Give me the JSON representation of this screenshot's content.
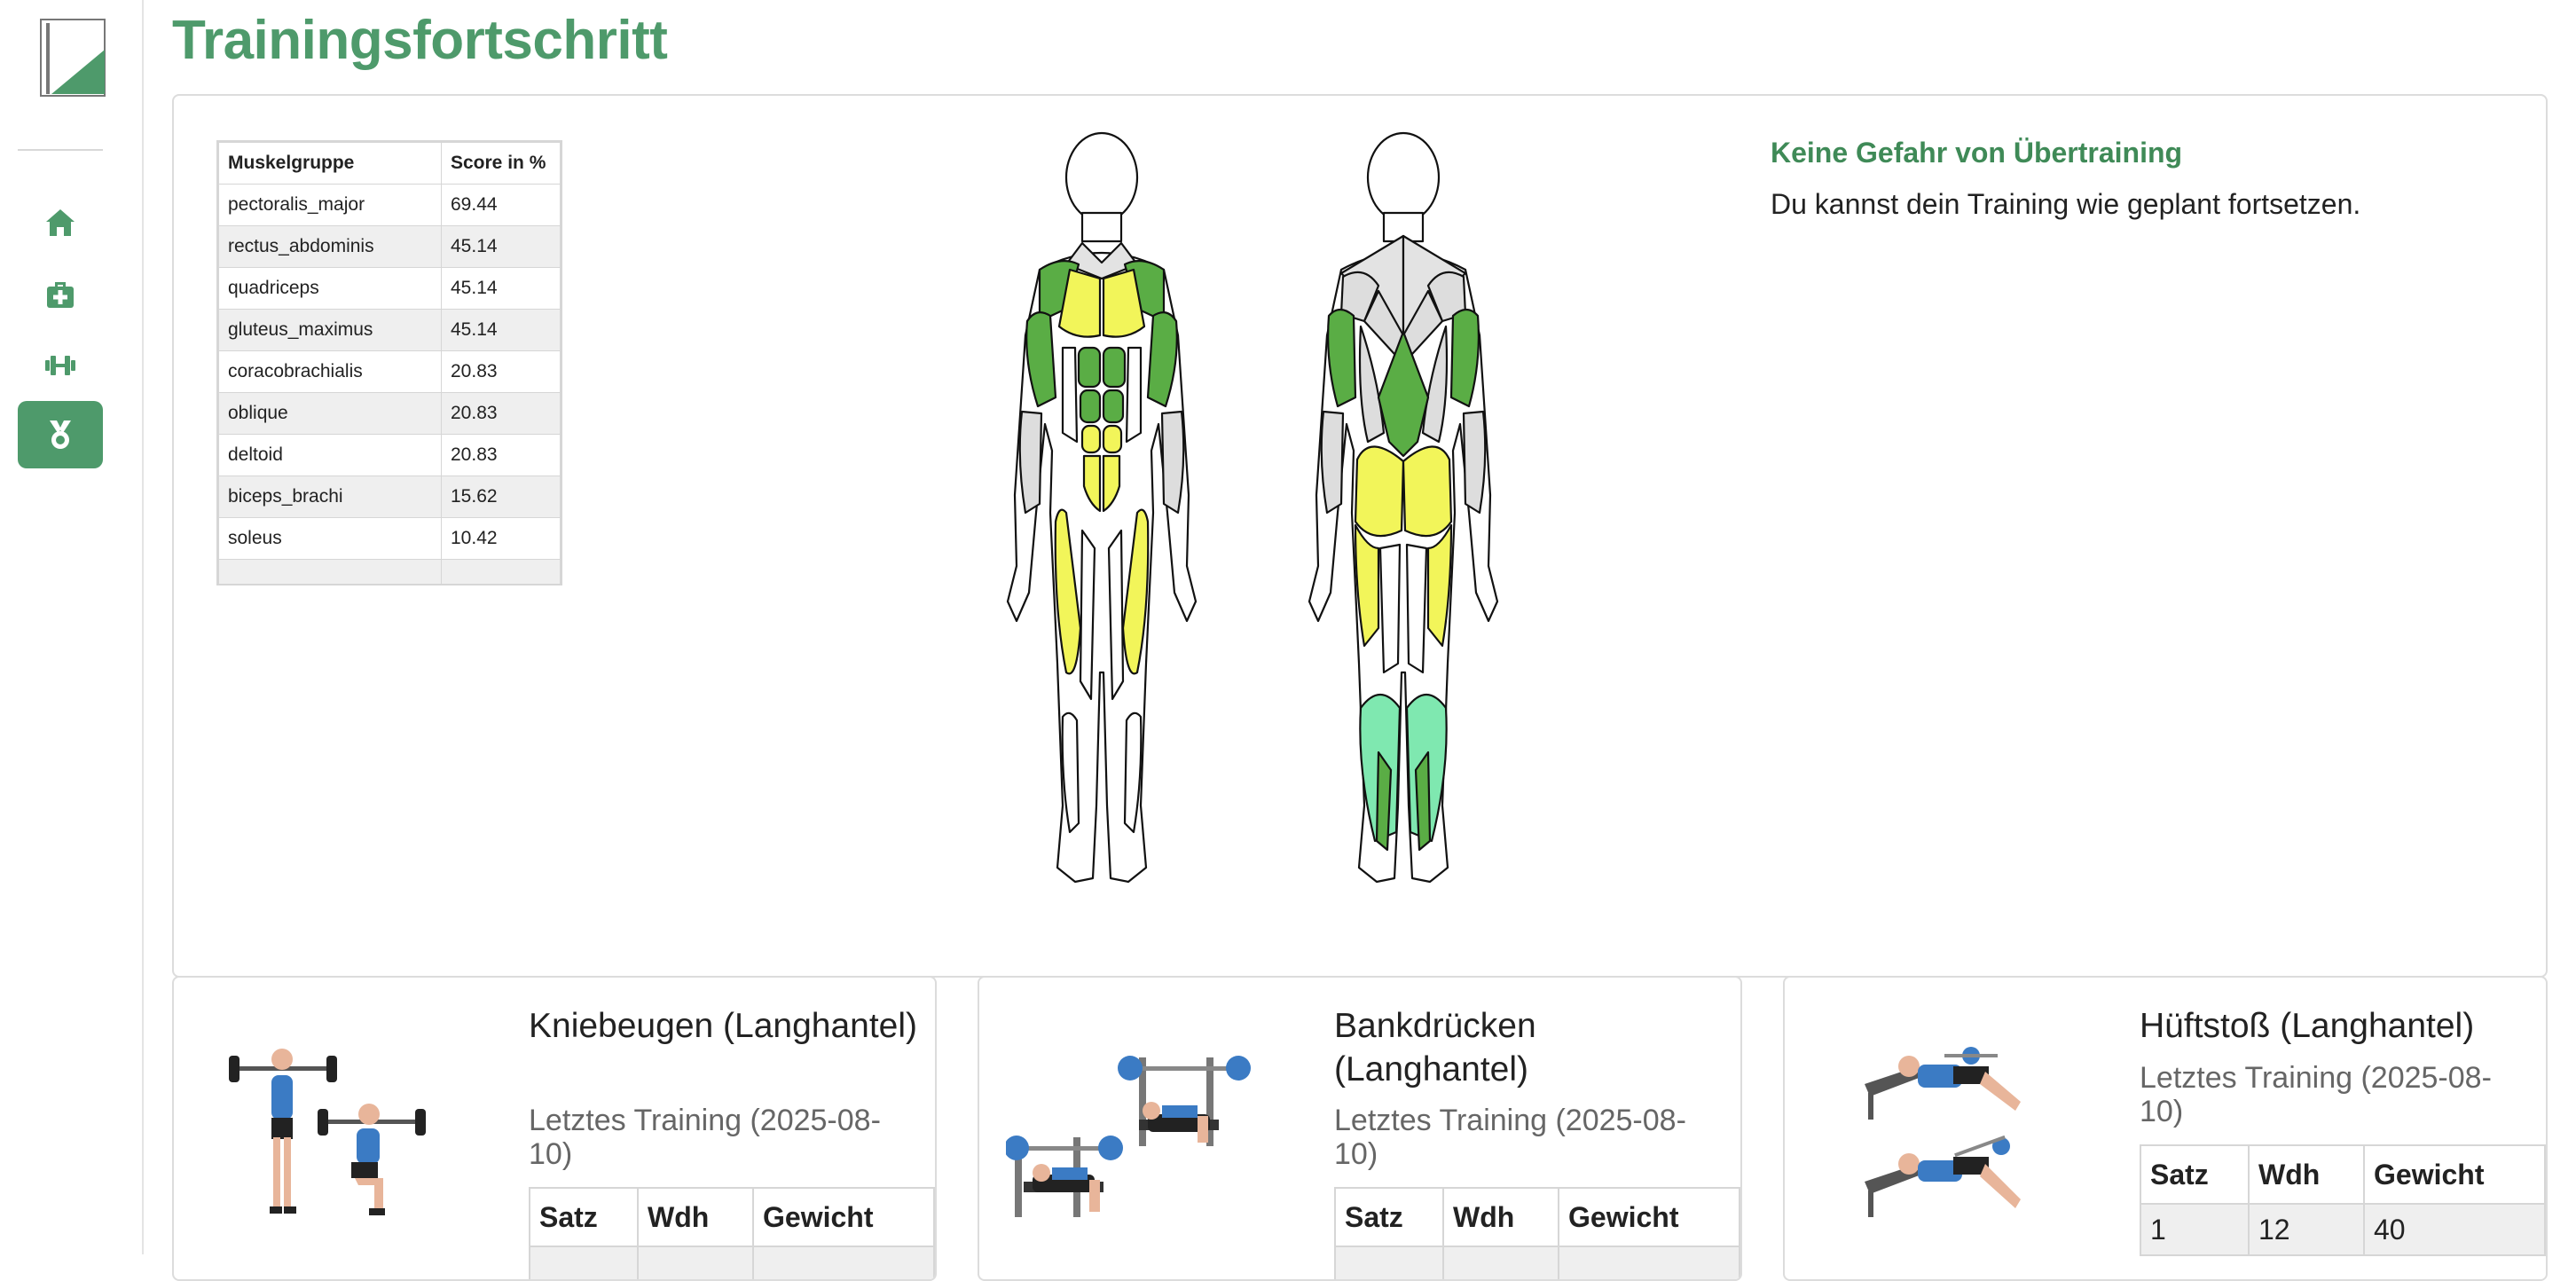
{
  "page": {
    "title": "Trainingsfortschritt"
  },
  "sidebar": {
    "items": [
      {
        "icon": "home-icon"
      },
      {
        "icon": "medkit-icon"
      },
      {
        "icon": "dumbbell-icon"
      },
      {
        "icon": "medal-icon",
        "active": true
      }
    ]
  },
  "muscle_table": {
    "headers": [
      "Muskelgruppe",
      "Score in %"
    ],
    "rows": [
      [
        "pectoralis_major",
        "69.44"
      ],
      [
        "rectus_abdominis",
        "45.14"
      ],
      [
        "quadriceps",
        "45.14"
      ],
      [
        "gluteus_maximus",
        "45.14"
      ],
      [
        "coracobrachialis",
        "20.83"
      ],
      [
        "oblique",
        "20.83"
      ],
      [
        "deltoid",
        "20.83"
      ],
      [
        "biceps_brachi",
        "15.62"
      ],
      [
        "soleus",
        "10.42"
      ]
    ]
  },
  "status": {
    "title": "Keine Gefahr von Übertraining",
    "text": "Du kannst dein Training wie geplant fortsetzen."
  },
  "colors": {
    "accent": "#4e9a6b",
    "yellow": "#f2f55a",
    "green": "#5aad45",
    "mint": "#7fe8b0",
    "gray": "#dddddd"
  },
  "cards": [
    {
      "title": "Kniebeugen (Langhantel)",
      "last": "Letztes Training (2025-08-10)",
      "headers": [
        "Satz",
        "Wdh",
        "Gewicht"
      ],
      "rows": []
    },
    {
      "title": "Bankdrücken (Langhantel)",
      "last": "Letztes Training (2025-08-10)",
      "headers": [
        "Satz",
        "Wdh",
        "Gewicht"
      ],
      "rows": []
    },
    {
      "title": "Hüftstoß (Langhantel)",
      "last": "Letztes Training (2025-08-10)",
      "headers": [
        "Satz",
        "Wdh",
        "Gewicht"
      ],
      "rows": [
        [
          "1",
          "12",
          "40"
        ]
      ]
    }
  ]
}
